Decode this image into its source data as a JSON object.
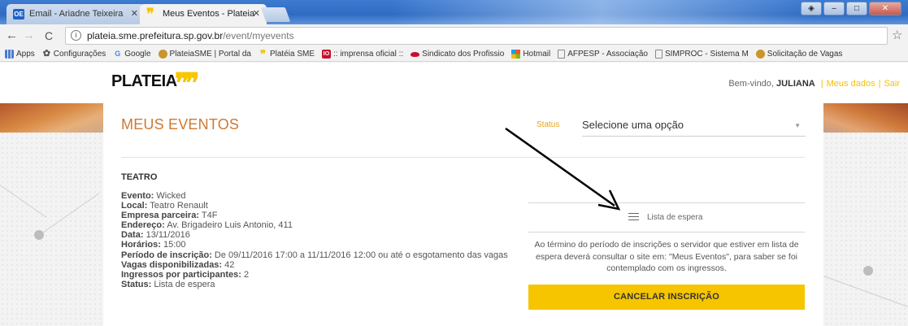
{
  "browser": {
    "tabs": [
      {
        "label": "Email - Ariadne Teixeira",
        "favicon": "OE",
        "active": false
      },
      {
        "label": "Meus Eventos - Plateia",
        "favicon": "❞",
        "active": true
      }
    ],
    "url_host": "plateia.sme.prefeitura.sp.gov.br",
    "url_path": "/event/myevents",
    "bookmarks": [
      {
        "label": "Apps",
        "icon": "apps-grid-icon"
      },
      {
        "label": "Configurações",
        "icon": "gear-icon"
      },
      {
        "label": "Google",
        "icon": "google-icon"
      },
      {
        "label": "PlateiaSME | Portal da",
        "icon": "sp-crest-icon"
      },
      {
        "label": "Platéia SME",
        "icon": "plateia-icon"
      },
      {
        "label": ":: imprensa oficial ::",
        "icon": "io-icon"
      },
      {
        "label": "Sindicato dos Profissio",
        "icon": "lips-icon"
      },
      {
        "label": "Hotmail",
        "icon": "windows-icon"
      },
      {
        "label": "AFPESP - Associação",
        "icon": "page-icon"
      },
      {
        "label": "SIMPROC - Sistema M",
        "icon": "page-icon"
      },
      {
        "label": "Solicitação de Vagas",
        "icon": "sp-crest-icon"
      }
    ]
  },
  "site": {
    "logo": "PLATEIA",
    "welcome_prefix": "Bem-vindo,",
    "user_name": "JULIANA",
    "link_my_data": "Meus dados",
    "link_logout": "Sair",
    "separator": "|"
  },
  "main": {
    "title": "MEUS EVENTOS",
    "status_label": "Status",
    "status_value": "Selecione uma opção",
    "event": {
      "category": "TEATRO",
      "fields": [
        {
          "label": "Evento:",
          "value": " Wicked"
        },
        {
          "label": "Local:",
          "value": " Teatro Renault"
        },
        {
          "label": "Empresa parceira:",
          "value": " T4F"
        },
        {
          "label": "Endereço:",
          "value": " Av. Brigadeiro Luis Antonio, 411"
        },
        {
          "label": "Data:",
          "value": " 13/11/2016"
        },
        {
          "label": "Horários:",
          "value": " 15:00"
        },
        {
          "label": "Período de inscrição:",
          "value": " De 09/11/2016 17:00 a 11/11/2016 12:00 ou até o esgotamento das vagas"
        },
        {
          "label": "Vagas disponibilizadas:",
          "value": " 42"
        },
        {
          "label": "Ingressos por participantes:",
          "value": " 2"
        },
        {
          "label": "Status:",
          "value": " Lista de espera"
        }
      ]
    },
    "waitlist_label": "Lista de espera",
    "note": "Ao término do período de inscrições o servidor que estiver em lista de espera deverá consultar o site em: \"Meus Eventos\", para saber se foi contemplado com os ingressos.",
    "cancel_button": "CANCELAR INSCRIÇÃO"
  },
  "colors": {
    "brand_yellow": "#f7c500",
    "title_orange": "#d0782f",
    "status_label": "#e8a11a"
  }
}
